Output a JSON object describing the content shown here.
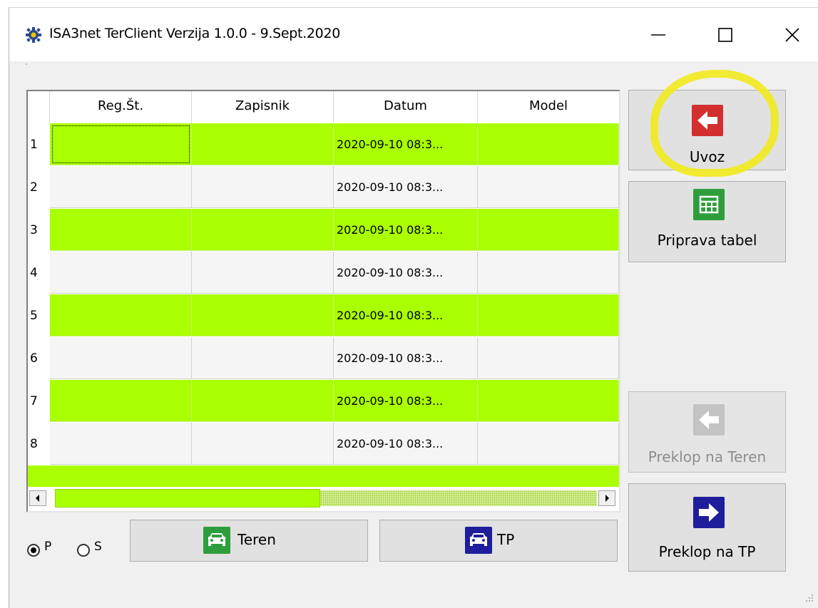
{
  "window": {
    "title": "ISA3net TerClient Verzija 1.0.0 - 9.Sept.2020",
    "icon": "gear-icon",
    "controls": [
      "minimize-icon",
      "maximize-icon",
      "close-icon"
    ]
  },
  "table": {
    "columns": [
      "Reg.Št.",
      "Zapisnik",
      "Datum",
      "Model"
    ],
    "rows": [
      {
        "num": "1",
        "reg": "",
        "zapisnik": "",
        "datum": "2020-09-10 08:3...",
        "model": ""
      },
      {
        "num": "2",
        "reg": "",
        "zapisnik": "",
        "datum": "2020-09-10 08:3...",
        "model": ""
      },
      {
        "num": "3",
        "reg": "",
        "zapisnik": "",
        "datum": "2020-09-10 08:3...",
        "model": ""
      },
      {
        "num": "4",
        "reg": "",
        "zapisnik": "",
        "datum": "2020-09-10 08:3...",
        "model": ""
      },
      {
        "num": "5",
        "reg": "",
        "zapisnik": "",
        "datum": "2020-09-10 08:3...",
        "model": ""
      },
      {
        "num": "6",
        "reg": "",
        "zapisnik": "",
        "datum": "2020-09-10 08:3...",
        "model": ""
      },
      {
        "num": "7",
        "reg": "",
        "zapisnik": "",
        "datum": "2020-09-10 08:3...",
        "model": ""
      },
      {
        "num": "8",
        "reg": "",
        "zapisnik": "",
        "datum": "2020-09-10 08:3...",
        "model": ""
      }
    ],
    "row_color_alt": "#aaff00",
    "row_color_plain": "#f5f5f5"
  },
  "buttons": {
    "uvoz": {
      "label": "Uvoz",
      "icon": "arrow-left-icon",
      "color": "#d32f2f"
    },
    "priprava": {
      "label": "Priprava tabel",
      "icon": "table-icon",
      "color": "#2e9e3c"
    },
    "preklop_teren": {
      "label": "Preklop na Teren",
      "icon": "arrow-left-icon",
      "enabled": false
    },
    "preklop_tp": {
      "label": "Preklop na TP",
      "icon": "arrow-right-icon",
      "color": "#1e1e9c"
    },
    "teren": {
      "label": "Teren",
      "icon": "car-icon",
      "color": "#2e9e3c"
    },
    "tp": {
      "label": "TP",
      "icon": "car-icon",
      "color": "#1e1e9c"
    }
  },
  "radios": {
    "p": {
      "label": "P",
      "checked": true
    },
    "s": {
      "label": "S",
      "checked": false
    }
  },
  "annotation_color": "#f2ea1e"
}
